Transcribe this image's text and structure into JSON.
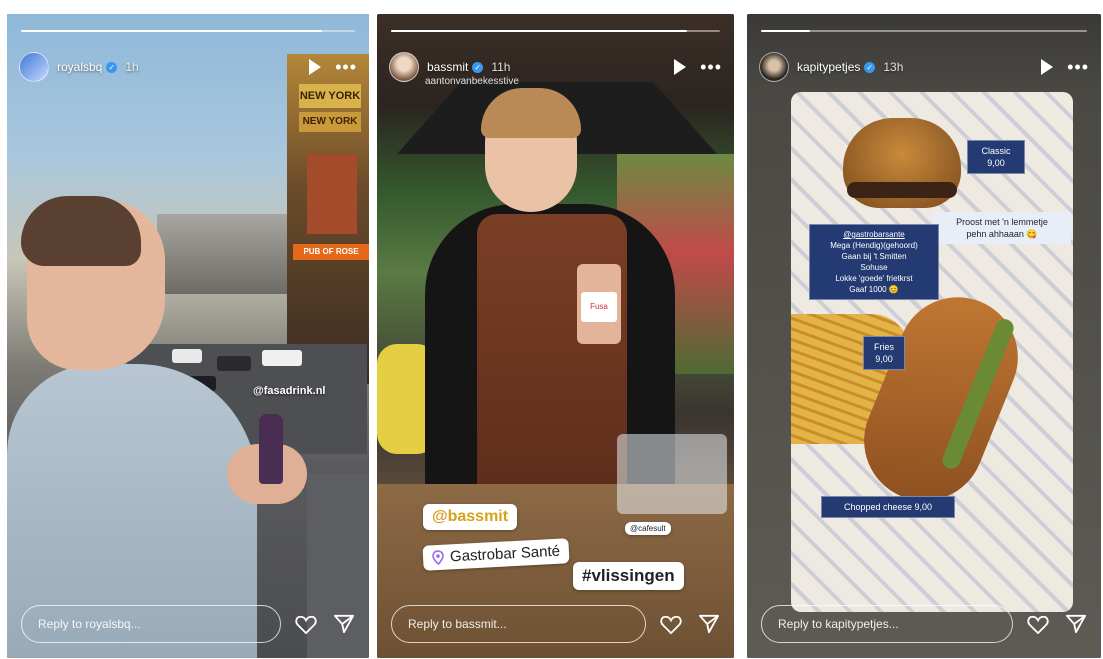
{
  "stories": [
    {
      "username": "royalsbq",
      "verified": true,
      "time": "1h",
      "progress": 0.9,
      "reply_placeholder": "Reply to royalsbq...",
      "stickers": {
        "mention": "@fasadrink.nl"
      },
      "scene": {
        "sign1": "NEW YORK",
        "sign2": "NEW YORK",
        "sign3": "PUB OF ROSE"
      }
    },
    {
      "username": "bassmit",
      "verified": true,
      "time": "11h",
      "subline": "aantonvanbekesstive",
      "progress": 0.9,
      "reply_placeholder": "Reply to bassmit...",
      "stickers": {
        "mention": "@bassmit",
        "location": "Gastrobar Santé",
        "small_tag": "@cafesult",
        "hashtag": "#vlissingen",
        "bottle_label": "Fusa"
      }
    },
    {
      "username": "kapitypetjes",
      "verified": true,
      "time": "13h",
      "progress": 0.15,
      "reply_placeholder": "Reply to kapitypetjes...",
      "stickers": {
        "classic": [
          "Classic",
          "9,00"
        ],
        "note": [
          "Proost met 'n lemmetje",
          "pehn ahhaaan 😋"
        ],
        "review": [
          "@gastrobarsante",
          "Mega (Hendig)(gehoord)",
          "Gaan bij 't Smitten",
          "Sohuse",
          "Lokke 'goede' frietkrst",
          "Gaaf 1000 😊"
        ],
        "fries": [
          "Fries",
          "9,00"
        ],
        "chopped": "Chopped cheese 9,00"
      }
    }
  ]
}
